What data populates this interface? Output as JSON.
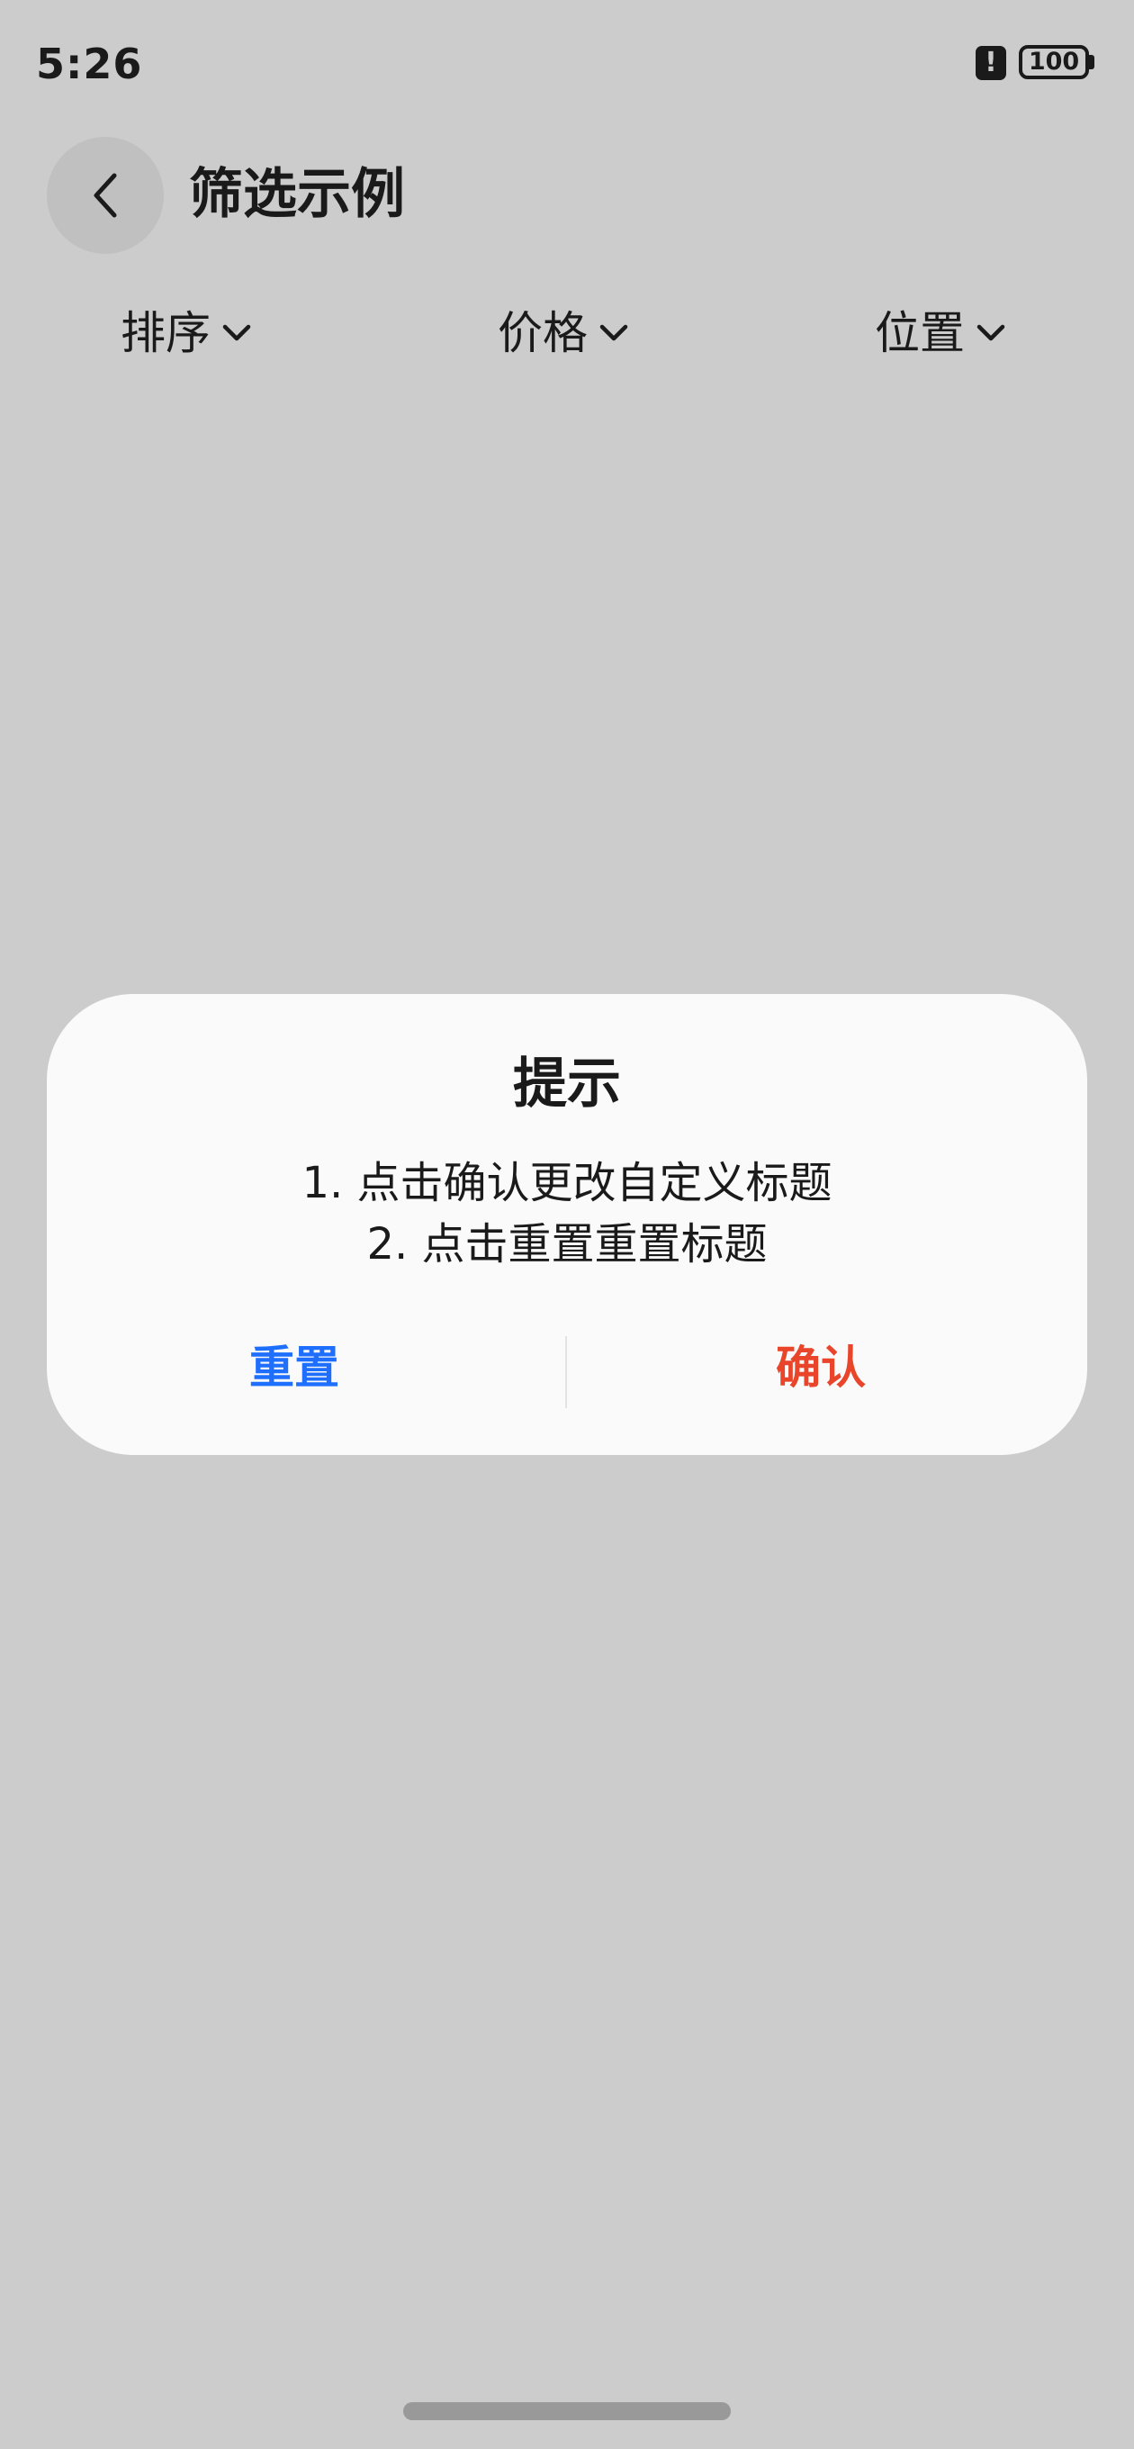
{
  "status_bar": {
    "time": "5:26",
    "alert_glyph": "!",
    "battery": "100"
  },
  "header": {
    "title": "筛选示例",
    "back_icon": "chevron-left-icon"
  },
  "filters": [
    {
      "label": "排序",
      "icon": "chevron-down-icon"
    },
    {
      "label": "价格",
      "icon": "chevron-down-icon"
    },
    {
      "label": "位置",
      "icon": "chevron-down-icon"
    }
  ],
  "dialog": {
    "title": "提示",
    "message_lines": [
      "1. 点击确认更改自定义标题",
      "2. 点击重置重置标题"
    ],
    "reset_label": "重置",
    "confirm_label": "确认"
  },
  "colors": {
    "background": "#cccccc",
    "dialog": "#fafafa",
    "reset": "#1f6fff",
    "confirm": "#e8452b",
    "text": "#1a1a1a"
  }
}
